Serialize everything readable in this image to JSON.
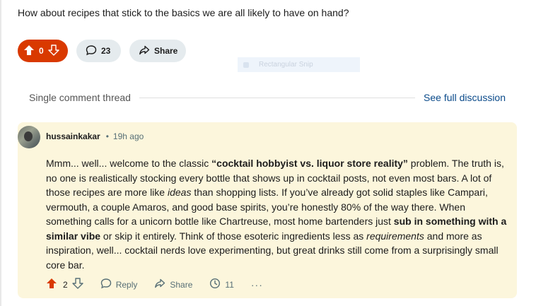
{
  "post": {
    "question": "How about recipes that stick to the basics we are all likely to have on hand?",
    "vote_count": "0",
    "comment_count": "23",
    "share_label": "Share"
  },
  "overlay": {
    "snip_label": "Rectangular Snip"
  },
  "thread": {
    "label": "Single comment thread",
    "full_discussion_link": "See full discussion"
  },
  "comment": {
    "author": "hussainkakar",
    "separator": "•",
    "time": "19h ago",
    "body": [
      {
        "t": "Mmm... well... welcome to the classic ",
        "s": ""
      },
      {
        "t": "“cocktail hobbyist vs. liquor store reality”",
        "s": "b"
      },
      {
        "t": " problem. The truth is, no one is realistically stocking every bottle that shows up in cocktail posts, not even most bars. A lot of those recipes are more like ",
        "s": ""
      },
      {
        "t": "ideas",
        "s": "i"
      },
      {
        "t": " than shopping lists. If you’ve already got solid staples like Campari, vermouth, a couple Amaros, and good base spirits, you’re honestly 80% of the way there. When something calls for a unicorn bottle like Chartreuse, most home bartenders just ",
        "s": ""
      },
      {
        "t": "sub in something with a similar vibe",
        "s": "b"
      },
      {
        "t": " or skip it entirely. Think of those esoteric ingredients less as ",
        "s": ""
      },
      {
        "t": "requirements",
        "s": "i"
      },
      {
        "t": " and more as inspiration, well... cocktail nerds love experimenting, but great drinks still come from a surprisingly small core bar.",
        "s": ""
      }
    ],
    "vote_count": "2",
    "reply_label": "Reply",
    "share_label": "Share",
    "award_count": "11",
    "more_label": "···"
  },
  "icons": {
    "upvote": "arrow-up-icon",
    "downvote": "arrow-down-icon",
    "comment": "speech-bubble-icon",
    "share": "share-arrow-icon",
    "award": "clock-icon"
  },
  "colors": {
    "upvote_active": "#d93900",
    "pill_bg": "#e5ebee",
    "highlight_bg": "#fcf6dc",
    "link": "#0a4a8a"
  }
}
